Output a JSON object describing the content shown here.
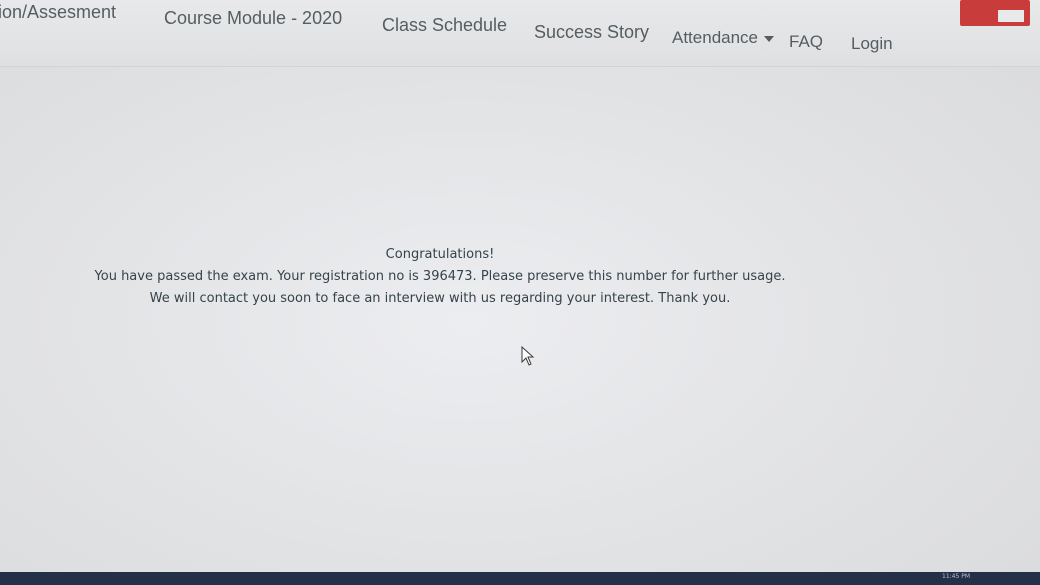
{
  "nav": {
    "items": [
      {
        "label": "ion/Assesment"
      },
      {
        "label": "Course Module - 2020"
      },
      {
        "label": "Class Schedule"
      },
      {
        "label": "Success Story"
      },
      {
        "label": "Attendance"
      },
      {
        "label": "FAQ"
      },
      {
        "label": "Login"
      }
    ]
  },
  "message": {
    "title": "Congratulations!",
    "line1": "You have passed the exam. Your registration no is 396473. Please preserve this number for further usage.",
    "line2": "We will contact you soon to face an interview with us regarding your interest. Thank you."
  },
  "taskbar": {
    "time": "11:45 PM"
  },
  "colors": {
    "accent_strip": "#3f8c3f",
    "nav_text": "#555d62",
    "message_text": "#35434a",
    "taskbar": "#243047"
  }
}
